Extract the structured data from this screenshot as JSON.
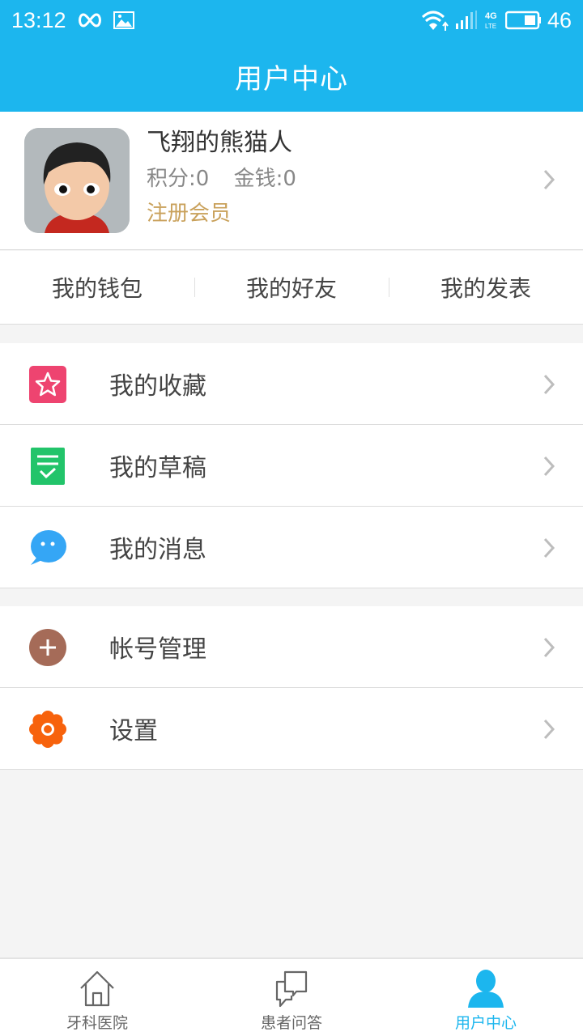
{
  "status_bar": {
    "time": "13:12",
    "battery_level": "46",
    "network": "4G LTE",
    "icons": [
      "infinity-icon",
      "image-icon",
      "wifi-icon",
      "signal-icon",
      "battery-icon"
    ]
  },
  "header": {
    "title": "用户中心"
  },
  "profile": {
    "name": "飞翔的熊猫人",
    "points_label": "积分:0",
    "money_label": "金钱:0",
    "member_level": "注册会员",
    "member_color": "#c9a15b"
  },
  "quick_links": [
    {
      "label": "我的钱包"
    },
    {
      "label": "我的好友"
    },
    {
      "label": "我的发表"
    }
  ],
  "menu_group1": [
    {
      "label": "我的收藏",
      "icon": "star-icon",
      "color": "#ee4470"
    },
    {
      "label": "我的草稿",
      "icon": "draft-icon",
      "color": "#22c46a"
    },
    {
      "label": "我的消息",
      "icon": "message-icon",
      "color": "#35a6f5"
    }
  ],
  "menu_group2": [
    {
      "label": "帐号管理",
      "icon": "account-add-icon",
      "color": "#a56b58"
    },
    {
      "label": "设置",
      "icon": "settings-flower-icon",
      "color": "#f7620c"
    }
  ],
  "tab_bar": {
    "tabs": [
      {
        "label": "牙科医院",
        "icon": "home-icon",
        "active": false
      },
      {
        "label": "患者问答",
        "icon": "chat-icon",
        "active": false
      },
      {
        "label": "用户中心",
        "icon": "user-icon",
        "active": true
      }
    ],
    "accent": "#1cb6ee"
  }
}
